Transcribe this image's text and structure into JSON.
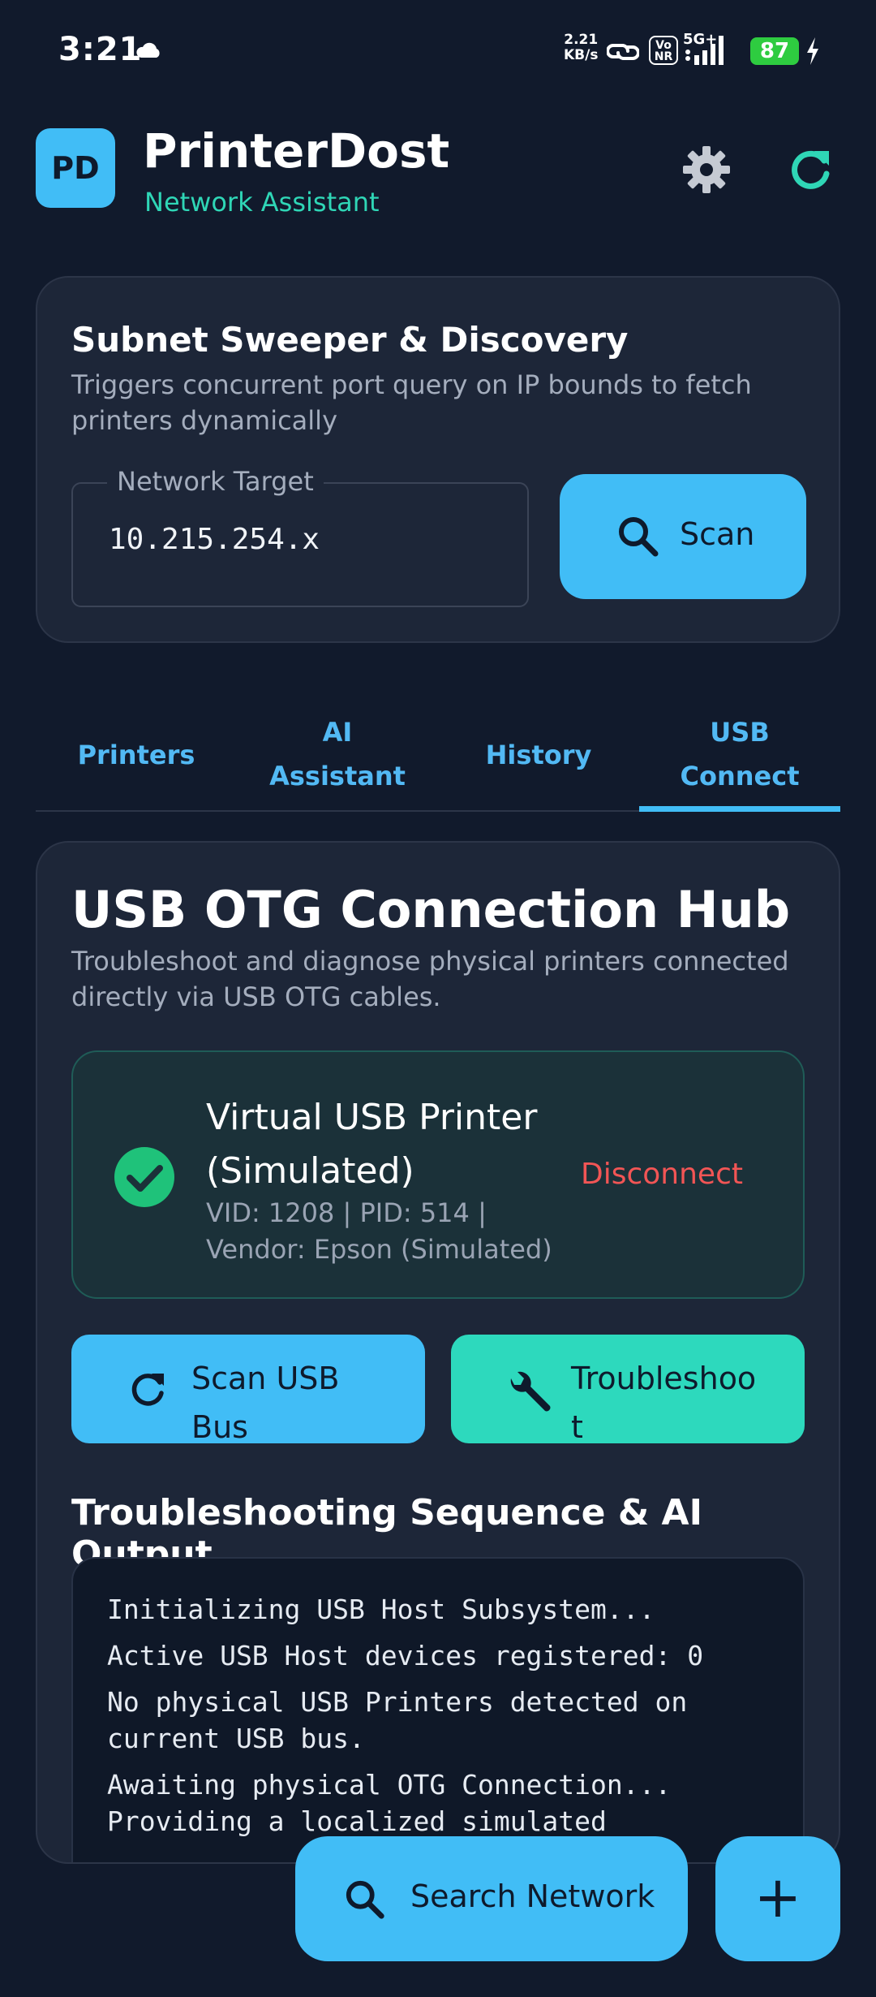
{
  "status_bar": {
    "time": "3:21",
    "net_speed_value": "2.21",
    "net_speed_unit": "KB/s",
    "vonr_top": "Vo",
    "vonr_bottom": "NR",
    "network_type": "5G+",
    "battery_level": "87",
    "icons": [
      "cloud-icon",
      "link-icon",
      "signal-icon",
      "battery-icon",
      "charging-bolt-icon"
    ]
  },
  "header": {
    "logo_text": "PD",
    "title": "PrinterDost",
    "subtitle": "Network Assistant",
    "icons": [
      "gear-icon",
      "refresh-icon"
    ]
  },
  "sweeper": {
    "title": "Subnet Sweeper & Discovery",
    "description": "Triggers concurrent port query on IP bounds to fetch printers dynamically",
    "field_label": "Network Target",
    "field_value": "10.215.254.x",
    "scan_label": "Scan"
  },
  "tabs": [
    {
      "label_line1": "Printers",
      "label_line2": ""
    },
    {
      "label_line1": "AI",
      "label_line2": "Assistant"
    },
    {
      "label_line1": "History",
      "label_line2": ""
    },
    {
      "label_line1": "USB",
      "label_line2": "Connect"
    }
  ],
  "active_tab": "USB Connect",
  "usb_hub": {
    "title": "USB OTG Connection Hub",
    "description": "Troubleshoot and diagnose physical printers connected directly via USB OTG cables.",
    "device": {
      "name": "Virtual USB Printer (Simulated)",
      "meta": "VID: 1208 | PID: 514 | Vendor: Epson (Simulated)",
      "disconnect_label": "Disconnect"
    },
    "scan_bus_label_line1": "Scan USB",
    "scan_bus_label_line2": "Bus",
    "troubleshoot_label_line1": "Troubleshoo",
    "troubleshoot_label_line2": "t",
    "sequence_title": "Troubleshooting Sequence & AI Output",
    "console_lines": [
      "Initializing USB Host Subsystem...",
      "Active USB Host devices registered: 0",
      "No physical USB Printers detected on current USB bus.",
      "Awaiting physical OTG Connection... Providing a localized simulated"
    ]
  },
  "fab": {
    "search_label": "Search Network",
    "add_label": "+"
  },
  "colors": {
    "background": "#111a2c",
    "card": "#1d2638",
    "accent_blue": "#41bdf6",
    "accent_teal": "#2dd9bd",
    "danger": "#f25555",
    "success": "#1fc27a"
  }
}
